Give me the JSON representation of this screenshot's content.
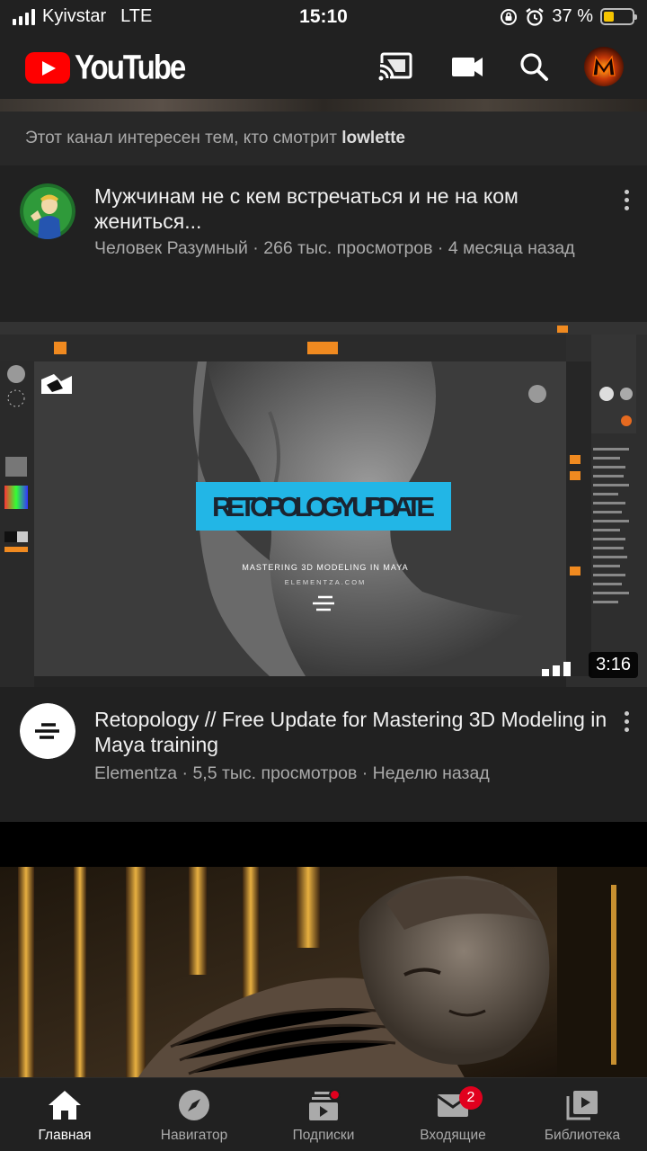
{
  "status_bar": {
    "carrier": "Kyivstar",
    "network": "LTE",
    "time": "15:10",
    "battery": "37 %",
    "battery_level": 0.37
  },
  "app_bar": {
    "logo_text": "YouTube",
    "icons": [
      "cast-icon",
      "video-camera-icon",
      "search-icon",
      "account-avatar"
    ]
  },
  "feed": {
    "shelf_note": {
      "prefix": "Этот канал интересен тем, кто смотрит",
      "channel": "lowlette"
    },
    "items": [
      {
        "title": "Мужчинам не с кем встречаться и не на ком жениться...",
        "meta": "Человек Разумный · 266 тыс. просмотров · 4 месяца назад"
      },
      {
        "thumbnail_text": "RETOPOLOGY UPDATE",
        "thumbnail_subtitle": "MASTERING 3D MODELING IN MAYA",
        "thumbnail_site": "ELEMENTZA.COM",
        "duration": "3:16",
        "title": "Retopology // Free Update for Mastering 3D Modeling in Maya training",
        "meta": "Elementza · 5,5 тыс. просмотров · Неделю назад"
      }
    ]
  },
  "bottom_nav": {
    "tabs": [
      {
        "label": "Главная",
        "icon": "home-icon",
        "active": true
      },
      {
        "label": "Навигатор",
        "icon": "compass-icon"
      },
      {
        "label": "Подписки",
        "icon": "subscriptions-icon",
        "dot": true
      },
      {
        "label": "Входящие",
        "icon": "inbox-icon",
        "badge": "2"
      },
      {
        "label": "Библиотека",
        "icon": "library-icon"
      }
    ]
  },
  "colors": {
    "brand": "#ff0000",
    "background": "#212121",
    "accent_cyan": "#22b6e6"
  }
}
